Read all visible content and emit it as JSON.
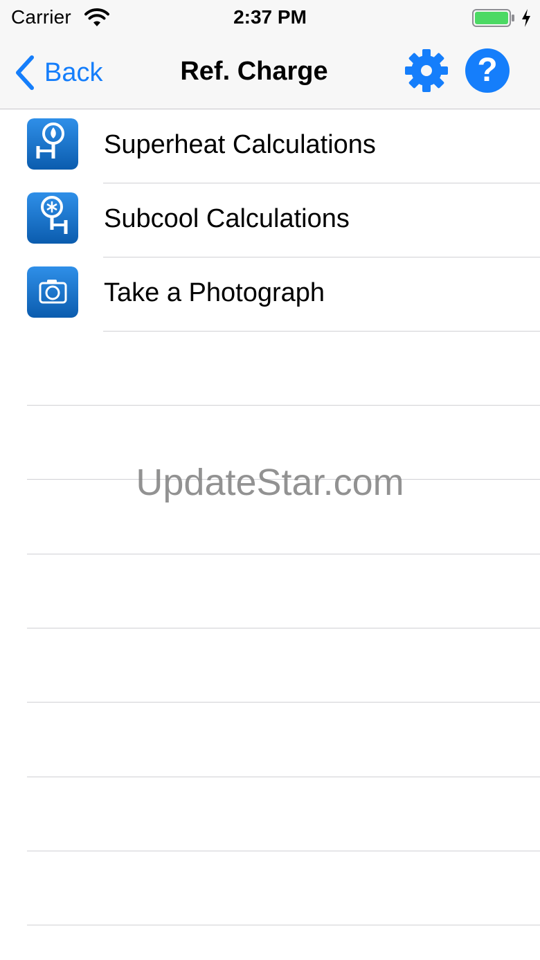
{
  "status_bar": {
    "carrier": "Carrier",
    "time": "2:37 PM",
    "icons": [
      "wifi-icon",
      "battery-icon",
      "charging-bolt-icon"
    ]
  },
  "nav": {
    "back_label": "Back",
    "title": "Ref. Charge",
    "help_label": "?",
    "icons": [
      "chevron-left-icon",
      "gear-icon",
      "help-icon"
    ]
  },
  "menu": {
    "items": [
      {
        "label": "Superheat Calculations",
        "icon": "superheat-gauge-icon"
      },
      {
        "label": "Subcool Calculations",
        "icon": "subcool-gauge-icon"
      },
      {
        "label": "Take a Photograph",
        "icon": "camera-icon"
      }
    ]
  },
  "watermark": "UpdateStar.com",
  "colors": {
    "accent": "#157efb",
    "icon_gradient_top": "#2f8fe8",
    "icon_gradient_bottom": "#0b5cae",
    "separator": "#d0d0d4",
    "bar_background": "#f7f7f7",
    "battery_fill": "#4cd964"
  }
}
